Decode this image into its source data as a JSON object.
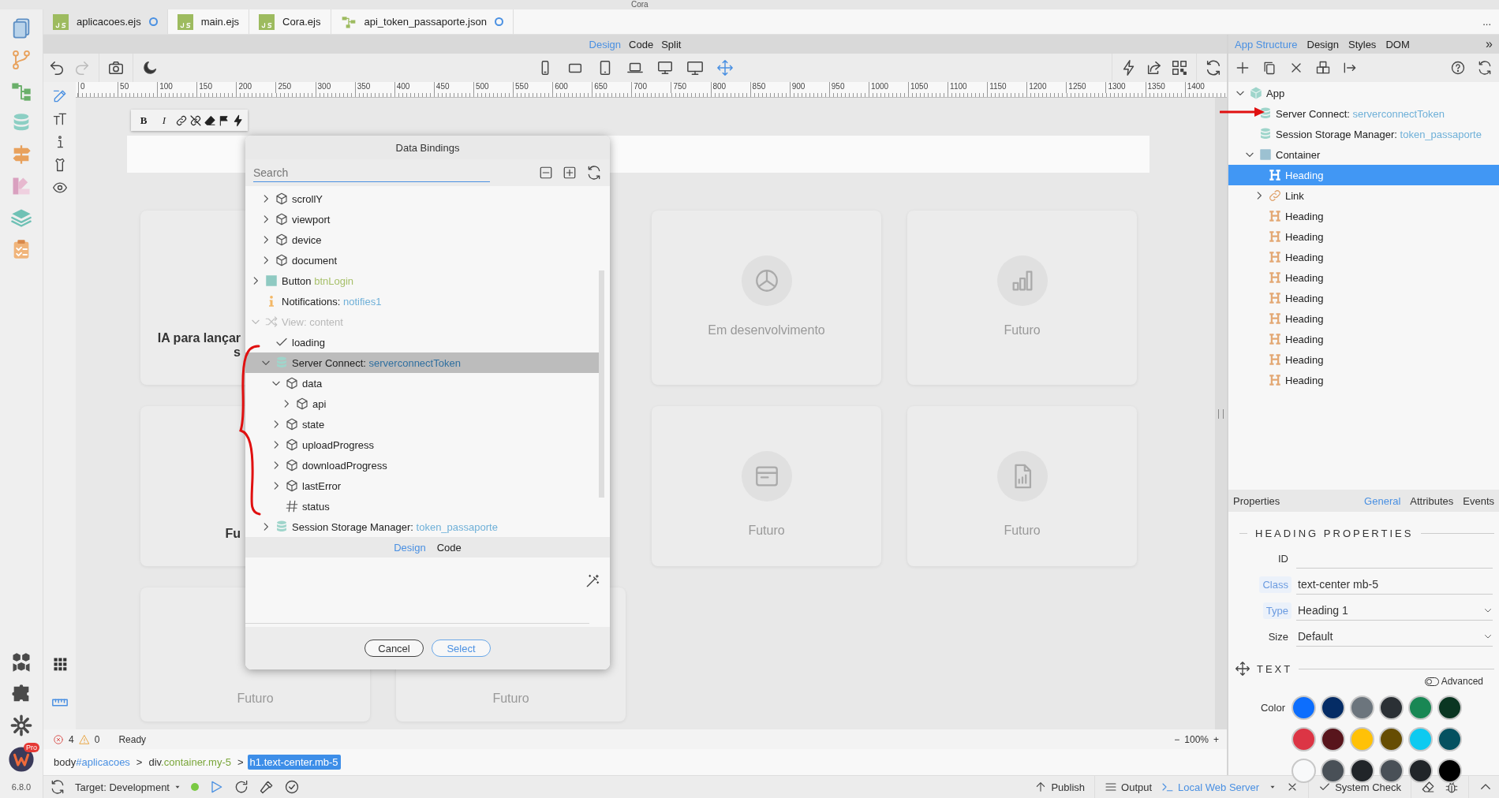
{
  "window": {
    "title": "Cora"
  },
  "file_tabs": [
    {
      "label": "aplicacoes.ejs",
      "kind": "js",
      "selected": true,
      "modified": true
    },
    {
      "label": "main.ejs",
      "kind": "js",
      "selected": false,
      "modified": false
    },
    {
      "label": "Cora.ejs",
      "kind": "js",
      "selected": false,
      "modified": false
    },
    {
      "label": "api_token_passaporte.json",
      "kind": "flow",
      "selected": false,
      "modified": true
    }
  ],
  "tabs_overflow": "...",
  "view_modes": [
    {
      "label": "Design",
      "selected": true
    },
    {
      "label": "Code",
      "selected": false
    },
    {
      "label": "Split",
      "selected": false
    }
  ],
  "history": [
    {
      "disabled": false
    },
    {
      "disabled": true
    }
  ],
  "devices": [
    {
      "selected": false
    },
    {
      "selected": false
    },
    {
      "selected": false
    },
    {
      "selected": false
    },
    {
      "selected": false
    },
    {
      "selected": false
    },
    {
      "selected": true
    }
  ],
  "tools": [
    {
      "selected": true
    },
    {
      "selected": false
    },
    {
      "selected": false
    },
    {
      "selected": false
    },
    {
      "selected": false
    }
  ],
  "ruler": [
    "0",
    "50",
    "100",
    "150",
    "200",
    "250",
    "300",
    "350",
    "400",
    "450",
    "500",
    "550",
    "600",
    "650",
    "700",
    "750",
    "800",
    "850",
    "900",
    "950",
    "1000",
    "1050",
    "1100",
    "1150",
    "1200",
    "1250",
    "1300",
    "1350",
    "1400"
  ],
  "format_buttons": [
    "B",
    "I"
  ],
  "cards": [
    {
      "lines": [
        "IA para lançar",
        "s"
      ],
      "covered": true
    },
    {
      "lines": [
        "Em desenvolvimento"
      ],
      "covered": false
    },
    {
      "lines": [
        "Futuro"
      ],
      "covered": false
    },
    {
      "lines": [
        "Fu"
      ],
      "covered": true
    },
    {
      "lines": [
        "Futuro"
      ],
      "covered": false
    },
    {
      "lines": [
        "Futuro"
      ],
      "covered": false
    },
    {
      "lines": [
        "Futuro"
      ],
      "covered": true
    },
    {
      "lines": [
        "Futuro"
      ],
      "covered": true
    }
  ],
  "data_bindings": {
    "title": "Data Bindings",
    "search": {
      "placeholder": "Search"
    },
    "scrolled_items": [
      {
        "label": "scrollY",
        "kind": "object",
        "expanded": false,
        "selected": false,
        "dimmed": false
      },
      {
        "label": "viewport",
        "kind": "object",
        "expanded": false,
        "selected": false,
        "dimmed": false
      },
      {
        "label": "device",
        "kind": "object",
        "expanded": false,
        "selected": false,
        "dimmed": false
      },
      {
        "label": "document",
        "kind": "object",
        "expanded": false,
        "selected": false,
        "dimmed": false
      }
    ],
    "tree": [
      {
        "label": "Button",
        "ref": "btnLogin",
        "kind": "element",
        "expanded": false,
        "selected": false,
        "dimmed": false
      },
      {
        "label": "Notifications:",
        "ref": "notifies1",
        "kind": "info",
        "selected": false,
        "dimmed": false
      },
      {
        "label": "View: content",
        "kind": "view",
        "expanded": true,
        "selected": false,
        "dimmed": true,
        "children": [
          {
            "label": "loading",
            "kind": "boolean",
            "selected": false,
            "dimmed": false
          },
          {
            "label": "Server Connect:",
            "ref": "serverconnectToken",
            "kind": "data",
            "expanded": true,
            "selected": true,
            "dimmed": false,
            "children": [
              {
                "label": "data",
                "kind": "object",
                "expanded": true,
                "selected": false,
                "dimmed": false,
                "children": [
                  {
                    "label": "api",
                    "kind": "object",
                    "expanded": false,
                    "selected": false,
                    "dimmed": false
                  }
                ]
              },
              {
                "label": "state",
                "kind": "object",
                "expanded": false,
                "selected": false,
                "dimmed": false
              },
              {
                "label": "uploadProgress",
                "kind": "object",
                "expanded": false,
                "selected": false,
                "dimmed": false
              },
              {
                "label": "downloadProgress",
                "kind": "object",
                "expanded": false,
                "selected": false,
                "dimmed": false
              },
              {
                "label": "lastError",
                "kind": "object",
                "expanded": false,
                "selected": false,
                "dimmed": false
              },
              {
                "label": "status",
                "kind": "number",
                "selected": false,
                "dimmed": false
              }
            ]
          },
          {
            "label": "Session Storage Manager:",
            "ref": "token_passaporte",
            "kind": "data",
            "expanded": false,
            "selected": false,
            "dimmed": false
          }
        ]
      }
    ],
    "editor_tabs": [
      {
        "label": "Design",
        "selected": true
      },
      {
        "label": "Code",
        "selected": false
      }
    ],
    "buttons": [
      {
        "label": "Cancel",
        "kind": "secondary"
      },
      {
        "label": "Select",
        "kind": "primary"
      }
    ]
  },
  "panel_tabs": [
    {
      "label": "App Structure",
      "selected": true
    },
    {
      "label": "Design",
      "selected": false
    },
    {
      "label": "Styles",
      "selected": false
    },
    {
      "label": "DOM",
      "selected": false
    }
  ],
  "panel_more": "»",
  "structure": [
    {
      "label": "App",
      "kind": "app",
      "expanded": true,
      "selected": false,
      "children": [
        {
          "label": "Server Connect:",
          "ref": "serverconnectToken",
          "kind": "data",
          "selected": false
        },
        {
          "label": "Session Storage Manager:",
          "ref": "token_passaporte",
          "kind": "data",
          "selected": false
        },
        {
          "label": "Container",
          "kind": "container",
          "expanded": true,
          "selected": false,
          "children": [
            {
              "label": "Heading",
              "kind": "heading",
              "selected": true
            },
            {
              "label": "Link",
              "kind": "link",
              "expanded": false,
              "selected": false
            },
            {
              "label": "Heading",
              "kind": "heading",
              "selected": false
            },
            {
              "label": "Heading",
              "kind": "heading",
              "selected": false
            },
            {
              "label": "Heading",
              "kind": "heading",
              "selected": false
            },
            {
              "label": "Heading",
              "kind": "heading",
              "selected": false
            },
            {
              "label": "Heading",
              "kind": "heading",
              "selected": false
            },
            {
              "label": "Heading",
              "kind": "heading",
              "selected": false
            },
            {
              "label": "Heading",
              "kind": "heading",
              "selected": false
            },
            {
              "label": "Heading",
              "kind": "heading",
              "selected": false
            },
            {
              "label": "Heading",
              "kind": "heading",
              "selected": false
            }
          ]
        }
      ]
    }
  ],
  "properties": {
    "title": "Properties",
    "tabs": [
      {
        "label": "General",
        "selected": true
      },
      {
        "label": "Attributes",
        "selected": false
      },
      {
        "label": "Events",
        "selected": false
      }
    ],
    "section": "HEADING PROPERTIES",
    "fields": [
      {
        "label": "ID",
        "kind": "text",
        "highlighted": false
      },
      {
        "label": "Class",
        "value": "text-center mb-5",
        "kind": "text",
        "highlighted": true
      },
      {
        "label": "Type",
        "value": "Heading 1",
        "kind": "select",
        "highlighted": true
      },
      {
        "label": "Size",
        "value": "Default",
        "kind": "select",
        "highlighted": false
      }
    ],
    "text_section": "TEXT",
    "advanced": {
      "label": "Advanced",
      "on": false
    },
    "color_label": "Color",
    "colors": [
      {
        "color": "#0d6efd"
      },
      {
        "color": "#052c65"
      },
      {
        "color": "#6c757d"
      },
      {
        "color": "#2b3035"
      },
      {
        "color": "#198754"
      },
      {
        "color": "#0a3622"
      },
      {
        "color": "#dc3545"
      },
      {
        "color": "#58151c"
      },
      {
        "color": "#ffc107"
      },
      {
        "color": "#664d03"
      },
      {
        "color": "#0dcaf0"
      },
      {
        "color": "#055160"
      },
      {
        "color": "#f8f9fa"
      },
      {
        "color": "#495057"
      },
      {
        "color": "#212529"
      },
      {
        "color": "#495057"
      },
      {
        "color": "#212529"
      },
      {
        "color": "#000000"
      }
    ]
  },
  "status": {
    "errors": "4",
    "warnings": "0",
    "message": "Ready",
    "zoom_minus": "−",
    "zoom": "100%",
    "zoom_plus": "+"
  },
  "breadcrumb": [
    {
      "tag": "body",
      "suffix": "#aplicacoes",
      "kind": "id",
      "selected": false
    },
    {
      "separator": ">",
      "tag": "div",
      "suffix": ".container.my-5",
      "kind": "class",
      "selected": false
    },
    {
      "separator": ">",
      "tag": "h1",
      "suffix": ".text-center.mb-5",
      "kind": "class",
      "selected": true
    }
  ],
  "bottom_bar": {
    "target_label": "Target:",
    "target": "Development",
    "online": true,
    "publish": "Publish",
    "output": "Output",
    "server": "Local Web Server",
    "system_check": "System Check"
  },
  "version": "6.8.0",
  "edition_badge": "Pro"
}
